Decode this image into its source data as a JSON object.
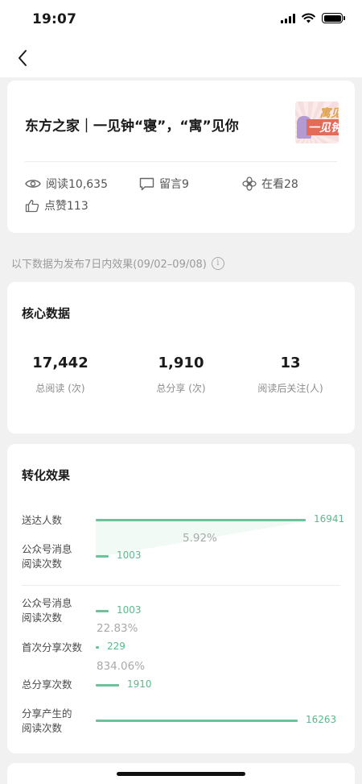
{
  "status_bar": {
    "time": "19:07"
  },
  "article": {
    "title": "东方之家｜一见钟“寝”，“寓”见你",
    "thumb_text_1": "寓见",
    "thumb_text_2": "一见钟",
    "stats": {
      "read": "阅读10,635",
      "comments": "留言9",
      "watching": "在看28",
      "likes": "点赞113"
    }
  },
  "note": {
    "text": "以下数据为发布7日内效果(09/02–09/08)",
    "info_icon_glyph": "i"
  },
  "core": {
    "title": "核心数据",
    "metrics": [
      {
        "value": "17,442",
        "label": "总阅读 (次)"
      },
      {
        "value": "1,910",
        "label": "总分享 (次)"
      },
      {
        "value": "13",
        "label": "阅读后关注(人)"
      }
    ]
  },
  "conversion": {
    "title": "转化效果",
    "rows": [
      {
        "label": "送达人数",
        "value": 16941
      },
      {
        "label": "公众号消息\n阅读次数",
        "value": 1003
      },
      {
        "label": "公众号消息\n阅读次数",
        "value": 1003
      },
      {
        "label": "首次分享次数",
        "value": 229
      },
      {
        "label": "总分享次数",
        "value": 1910
      },
      {
        "label": "分享产生的\n阅读次数",
        "value": 16263
      }
    ],
    "rates": [
      "5.92%",
      "22.83%",
      "834.06%"
    ],
    "bar_color": "#6ac49a",
    "max_value": 16941
  },
  "icons": {
    "back": "chevron-left-icon",
    "read": "eye-icon",
    "comments": "comment-icon",
    "watching": "flower-icon",
    "likes": "thumbs-up-icon"
  }
}
